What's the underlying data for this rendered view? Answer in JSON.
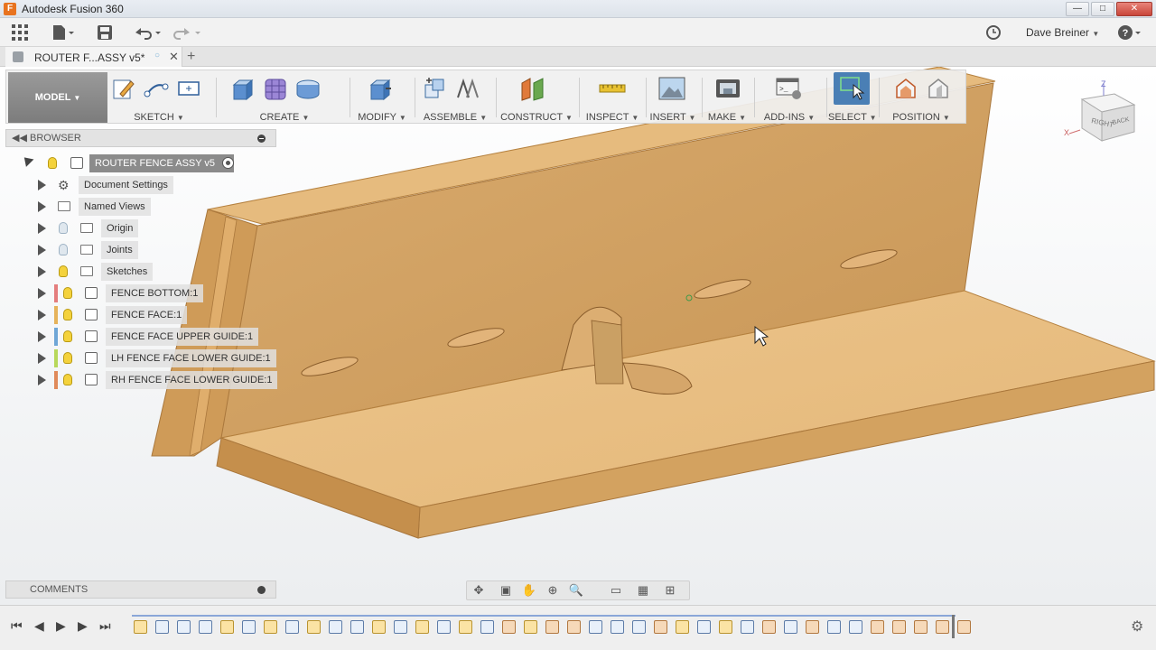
{
  "window": {
    "title": "Autodesk Fusion 360",
    "app_icon_letter": "F",
    "minimize": "—",
    "maximize": "□",
    "close": "✕"
  },
  "appbar": {
    "user": "Dave Breiner",
    "icons": [
      "grid-icon",
      "file-icon",
      "save-icon",
      "undo-icon",
      "redo-icon",
      "clock-icon",
      "help-icon"
    ]
  },
  "document_tab": {
    "title": "ROUTER F...ASSY v5*",
    "close": "✕",
    "add": "+"
  },
  "toolbar": {
    "workspace": "MODEL",
    "groups": [
      {
        "label": "SKETCH"
      },
      {
        "label": "CREATE"
      },
      {
        "label": "MODIFY"
      },
      {
        "label": "ASSEMBLE"
      },
      {
        "label": "CONSTRUCT"
      },
      {
        "label": "INSPECT"
      },
      {
        "label": "INSERT"
      },
      {
        "label": "MAKE"
      },
      {
        "label": "ADD-INS"
      },
      {
        "label": "SELECT"
      },
      {
        "label": "POSITION"
      }
    ]
  },
  "browser": {
    "title": "BROWSER",
    "root": "ROUTER FENCE ASSY v5",
    "items": [
      {
        "label": "Document Settings"
      },
      {
        "label": "Named Views"
      },
      {
        "label": "Origin"
      },
      {
        "label": "Joints"
      },
      {
        "label": "Sketches"
      },
      {
        "label": "FENCE BOTTOM:1"
      },
      {
        "label": "FENCE FACE:1"
      },
      {
        "label": "FENCE FACE UPPER GUIDE:1"
      },
      {
        "label": "LH FENCE FACE LOWER GUIDE:1"
      },
      {
        "label": "RH FENCE FACE LOWER GUIDE:1"
      }
    ]
  },
  "comments": {
    "title": "COMMENTS"
  },
  "viewcube": {
    "face_right": "RIGHT",
    "face_back": "BACK",
    "axis_z": "Z",
    "axis_x": "X"
  },
  "colors": {
    "wood_top": "#e2b57a",
    "wood_side": "#c99654",
    "wood_edge": "#b5813f",
    "select_active": "#4a7fb5"
  }
}
